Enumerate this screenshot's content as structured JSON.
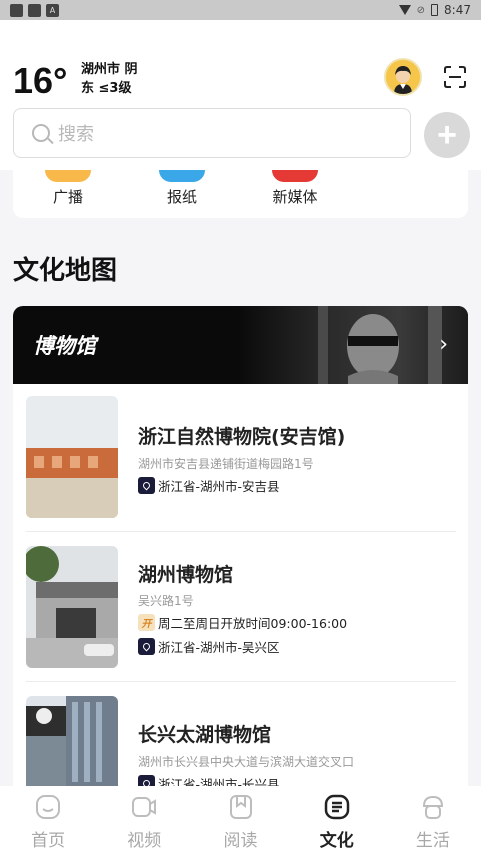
{
  "status_bar": {
    "time": "8:47"
  },
  "weather": {
    "temperature": "16°",
    "city_condition": "湖州市 阴",
    "wind": "东 ≤3级"
  },
  "search": {
    "placeholder": "搜索"
  },
  "media_shortcuts": [
    {
      "label": "广播",
      "color": "#f8b94a"
    },
    {
      "label": "报纸",
      "color": "#3aa7e8"
    },
    {
      "label": "新媒体",
      "color": "#e53935"
    }
  ],
  "section": {
    "title": "文化地图"
  },
  "banner": {
    "title": "博物馆"
  },
  "museums": [
    {
      "name": "浙江自然博物院(安吉馆)",
      "address": "湖州市安吉县递铺街道梅园路1号",
      "region": "浙江省-湖州市-安吉县"
    },
    {
      "name": "湖州博物馆",
      "address": "吴兴路1号",
      "hours": "周二至周日开放时间09:00-16:00",
      "region": "浙江省-湖州市-吴兴区"
    },
    {
      "name": "长兴太湖博物馆",
      "address": "湖州市长兴县中央大道与滨湖大道交叉口",
      "region": "浙江省-湖州市-长兴县"
    }
  ],
  "tabs": [
    {
      "label": "首页",
      "icon": "home-icon"
    },
    {
      "label": "视频",
      "icon": "video-icon"
    },
    {
      "label": "阅读",
      "icon": "read-icon"
    },
    {
      "label": "文化",
      "icon": "culture-icon",
      "active": true
    },
    {
      "label": "生活",
      "icon": "life-icon"
    }
  ]
}
